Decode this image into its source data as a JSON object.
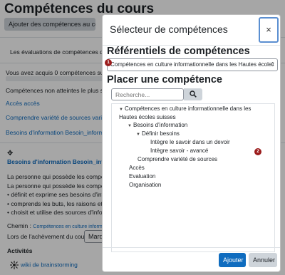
{
  "background": {
    "page_title": "Compétences du cours",
    "add_button_label": "Ajouter des compétences au cours",
    "evaluation_text": "Les évaluations de compétences de ce",
    "acquired_text": "Vous avez acquis 0 compétences sur 3 d",
    "not_reached_text": "Compétences non atteintes le plus souv",
    "link_access": "Accès accès",
    "link_variety": "Comprendre variété de sources variété_",
    "link_info": "Besoins d'information Besoin_information",
    "competency_heading": "Besoins d'information Besoin_informatio",
    "desc_lines": [
      "La personne qui possède les compétenc",
      "La personne qui possède les compétenc",
      "• définit et exprime ses besoins d'inform",
      "• comprends les buts, les raisons et la n",
      "• choisit et utilise des sources d'informa"
    ],
    "path_label": "Chemin :",
    "path_value": "Compétences en culture information",
    "completion_label": "Lors de l'achèvement du cours :",
    "completion_select": "Marq",
    "activities_title": "Activités",
    "activity_link": "wiki de brainstorming"
  },
  "modal": {
    "title": "Sélecteur de compétences",
    "close_label": "×",
    "frameworks_heading": "Référentiels de compétences",
    "framework_selected": "Compétences en culture informationnelle dans les Hautes école",
    "badge_1": "1",
    "place_heading": "Placer une compétence",
    "search_placeholder": "Recherche...",
    "tree": [
      {
        "label": "Compétences en culture informationnelle dans les",
        "expanded": true
      },
      {
        "label": "Hautes écoles suisses"
      },
      {
        "label": "Besoins d'information",
        "expanded": true
      },
      {
        "label": "Définir besoins",
        "expanded": true
      },
      {
        "label": "Intègre le savoir dans un devoir"
      },
      {
        "label": "Intègre savoir - avancé"
      },
      {
        "label": "Comprendre variété de sources"
      },
      {
        "label": "Accès"
      },
      {
        "label": "Evaluation"
      },
      {
        "label": "Organisation"
      }
    ],
    "badge_2": "2",
    "add_label": "Ajouter",
    "cancel_label": "Annuler"
  }
}
